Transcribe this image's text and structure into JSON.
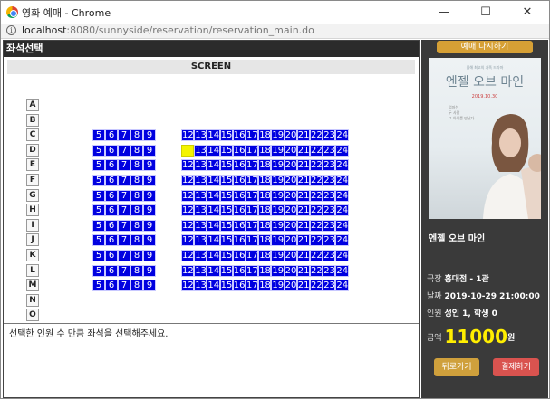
{
  "window": {
    "title": "영화 예매 - Chrome"
  },
  "address": {
    "host": "localhost",
    "path": ":8080/sunnyside/reservation/reservation_main.do"
  },
  "left_panel": {
    "header": "좌석선택",
    "screen_label": "SCREEN",
    "rows": [
      "A",
      "B",
      "C",
      "D",
      "E",
      "F",
      "G",
      "H",
      "I",
      "J",
      "K",
      "L",
      "M",
      "N",
      "O"
    ],
    "seat_rows": [
      "C",
      "D",
      "E",
      "F",
      "G",
      "H",
      "I",
      "J",
      "K",
      "L",
      "M"
    ],
    "left_block": [
      "5",
      "6",
      "7",
      "8",
      "9"
    ],
    "right_block": [
      "12",
      "13",
      "14",
      "15",
      "16",
      "17",
      "18",
      "19",
      "20",
      "21",
      "22",
      "23",
      "24"
    ],
    "selected_seat": {
      "row": "D",
      "number": "12"
    },
    "notice": "선택한 인원 수 만큼 좌석을 선택해주세요."
  },
  "right_panel": {
    "rebook_button": "예매 다시하기",
    "poster": {
      "top_text": "올해 최고의 가족 드라마",
      "title": "엔젤 오브 마인",
      "date": "2019.10.30",
      "lines": [
        "엄마는",
        "두 사람",
        "그 아이를 만났다"
      ]
    },
    "movie_title": "엔젤 오브 마인",
    "theater_label": "극장",
    "theater_value": "홍대점 - 1관",
    "date_label": "날짜",
    "date_value": "2019-10-29 21:00:00",
    "people_label": "인원",
    "people_value": "성인 1, 학생 0",
    "price_label": "금액",
    "price_value": "11000",
    "price_unit": "원",
    "back_button": "뒤로가기",
    "pay_button": "결제하기"
  },
  "colors": {
    "seat": "#0000e0",
    "selected": "#f4f400",
    "panel": "#3a3a3a"
  }
}
